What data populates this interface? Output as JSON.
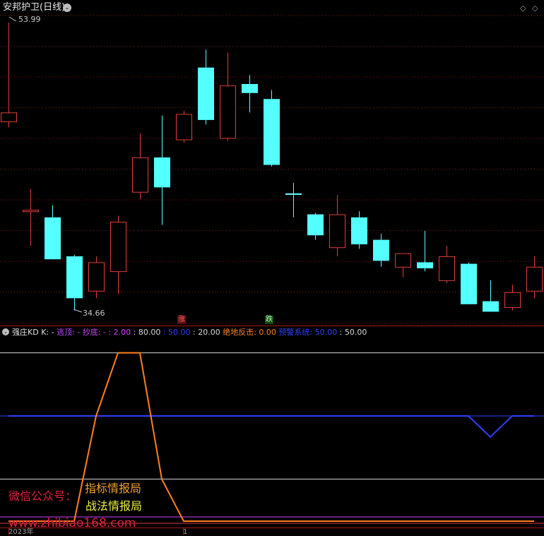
{
  "header": {
    "title": "安邦护卫(日线)",
    "dropdown_glyph": "⌄",
    "high_label": "53.99",
    "low_label": "34.66",
    "toolbar_icons": [
      "diamond-icon",
      "diamond-icon"
    ]
  },
  "signals": {
    "up": "涨",
    "down": "跌"
  },
  "indicator": {
    "name": "强庄KD",
    "k": "K: -",
    "items": [
      {
        "label": "逃顶: -",
        "color": "#c040ff"
      },
      {
        "label": "抄底: -",
        "color": "#d040ff"
      },
      {
        "label": ": 2.00",
        "color": "#d040ff"
      },
      {
        "label": ": 80.00",
        "color": "#d8d8d8"
      },
      {
        "label": ": 50.00",
        "color": "#3040ff"
      },
      {
        "label": ": 20.00",
        "color": "#d8d8d8"
      },
      {
        "label": "绝地反击: 0.00",
        "color": "#ff8020"
      },
      {
        "label": "预警系统: 50.00",
        "color": "#3040ff"
      },
      {
        "label": ": 50.00",
        "color": "#d8d8d8"
      }
    ]
  },
  "watermark": {
    "wechat": "微信公众号：",
    "name1": "指标情报局",
    "name2": "战法情报局",
    "site": "www.zhibiao168.com"
  },
  "axis": {
    "year": "2023年",
    "mark": "1"
  },
  "colors": {
    "up": "#e03c3c",
    "down": "#54ffff",
    "kd_line": "#ff8020",
    "warn_line": "#3040ff",
    "level_line": "#d8d8d8",
    "signal_line": "#d040ff",
    "grid": "#8a1a1a"
  },
  "chart_data": {
    "type": "candlestick",
    "price_range": [
      34.66,
      53.99
    ],
    "candles": [
      {
        "o": 47.2,
        "h": 53.8,
        "l": 46.8,
        "c": 47.8
      },
      {
        "o": 41.2,
        "h": 42.7,
        "l": 38.9,
        "c": 41.3
      },
      {
        "o": 40.8,
        "h": 41.6,
        "l": 38.0,
        "c": 38.0
      },
      {
        "o": 38.2,
        "h": 38.3,
        "l": 34.6,
        "c": 35.4
      },
      {
        "o": 35.9,
        "h": 38.2,
        "l": 35.4,
        "c": 37.8
      },
      {
        "o": 37.2,
        "h": 40.9,
        "l": 35.7,
        "c": 40.5
      },
      {
        "o": 42.5,
        "h": 46.4,
        "l": 42.0,
        "c": 44.8
      },
      {
        "o": 44.8,
        "h": 47.6,
        "l": 40.3,
        "c": 42.8
      },
      {
        "o": 46.0,
        "h": 47.9,
        "l": 45.8,
        "c": 47.7
      },
      {
        "o": 50.8,
        "h": 52.0,
        "l": 47.0,
        "c": 47.3
      },
      {
        "o": 46.1,
        "h": 51.8,
        "l": 45.9,
        "c": 49.6
      },
      {
        "o": 49.7,
        "h": 50.3,
        "l": 47.8,
        "c": 49.1
      },
      {
        "o": 48.7,
        "h": 49.3,
        "l": 44.2,
        "c": 44.3
      },
      {
        "o": 42.4,
        "h": 43.1,
        "l": 40.8,
        "c": 42.3
      },
      {
        "o": 41.0,
        "h": 41.1,
        "l": 39.3,
        "c": 39.6
      },
      {
        "o": 38.8,
        "h": 42.3,
        "l": 38.2,
        "c": 41.0
      },
      {
        "o": 40.8,
        "h": 41.2,
        "l": 38.7,
        "c": 39.0
      },
      {
        "o": 39.3,
        "h": 39.7,
        "l": 37.5,
        "c": 37.9
      },
      {
        "o": 37.5,
        "h": 38.2,
        "l": 36.8,
        "c": 38.4
      },
      {
        "o": 37.8,
        "h": 39.9,
        "l": 37.2,
        "c": 37.4
      },
      {
        "o": 36.6,
        "h": 38.9,
        "l": 36.4,
        "c": 38.2
      },
      {
        "o": 37.7,
        "h": 37.8,
        "l": 35.0,
        "c": 35.0
      },
      {
        "o": 35.2,
        "h": 36.6,
        "l": 34.7,
        "c": 34.5
      },
      {
        "o": 34.8,
        "h": 36.3,
        "l": 34.6,
        "c": 35.8
      },
      {
        "o": 35.9,
        "h": 38.2,
        "l": 35.4,
        "c": 37.5
      }
    ],
    "indicator_series": {
      "levels": [
        80,
        50,
        20,
        2
      ],
      "kd_line": [
        0,
        0,
        0,
        0,
        50,
        80,
        80,
        20,
        0,
        0,
        0,
        0,
        0,
        0,
        0,
        0,
        0,
        0,
        0,
        0,
        0,
        0,
        0,
        0,
        0
      ],
      "warn_line": [
        50,
        50,
        50,
        50,
        50,
        50,
        50,
        50,
        50,
        50,
        50,
        50,
        50,
        50,
        50,
        50,
        50,
        50,
        50,
        50,
        50,
        50,
        40,
        50,
        50
      ]
    }
  }
}
